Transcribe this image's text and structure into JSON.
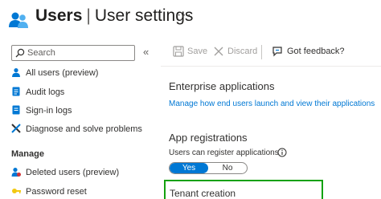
{
  "header": {
    "title_main": "Users",
    "title_separator": "|",
    "title_sub": "User settings",
    "more": "···"
  },
  "search": {
    "placeholder": "Search",
    "collapse_glyph": "«"
  },
  "nav": {
    "items": [
      {
        "label": "All users (preview)",
        "icon": "user-icon"
      },
      {
        "label": "Audit logs",
        "icon": "audit-log-icon"
      },
      {
        "label": "Sign-in logs",
        "icon": "sign-in-log-icon"
      },
      {
        "label": "Diagnose and solve problems",
        "icon": "wrench-icon"
      }
    ],
    "section": "Manage",
    "manage_items": [
      {
        "label": "Deleted users (preview)",
        "icon": "deleted-user-icon"
      },
      {
        "label": "Password reset",
        "icon": "key-icon"
      }
    ]
  },
  "toolbar": {
    "save": "Save",
    "discard": "Discard",
    "feedback": "Got feedback?"
  },
  "content": {
    "enterprise_heading": "Enterprise applications",
    "enterprise_link": "Manage how end users launch and view their applications",
    "app_reg_heading": "App registrations",
    "app_reg_label": "Users can register applications",
    "toggle_yes": "Yes",
    "toggle_no": "No",
    "toggle_selected": "Yes",
    "tenant_heading": "Tenant creation"
  },
  "colors": {
    "accent": "#0078d4",
    "highlight": "#13a10e"
  }
}
